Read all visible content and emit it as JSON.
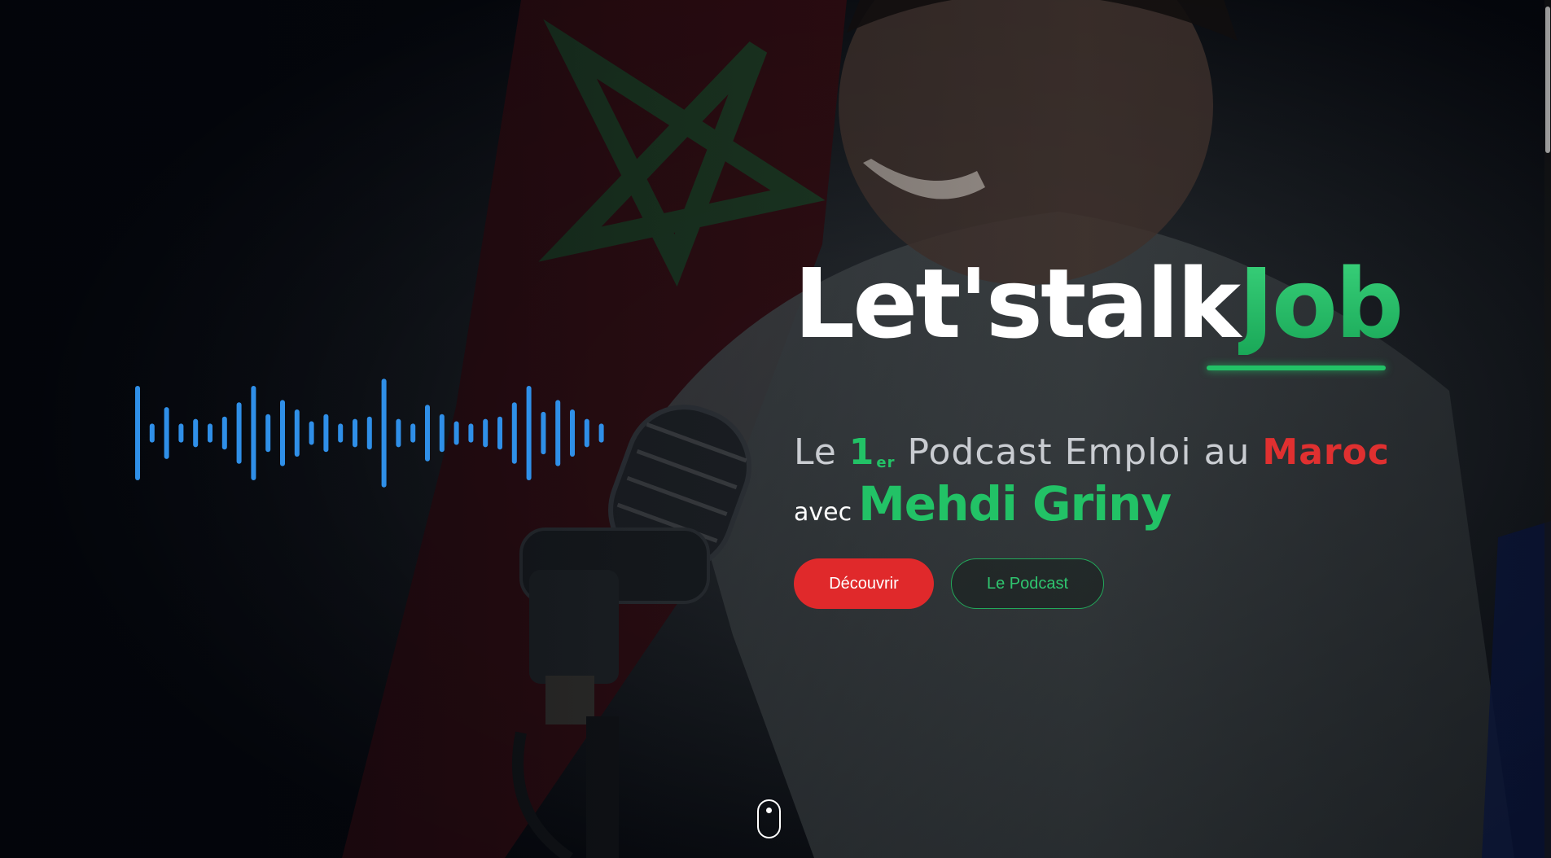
{
  "hero": {
    "title_part1": "Let'stalk",
    "title_part2": "Job",
    "tagline_prefix": "Le ",
    "tagline_rank": "1",
    "tagline_rank_suffix": "er",
    "tagline_middle": " Podcast Emploi au ",
    "tagline_country": "Maroc",
    "host_prefix": "avec",
    "host_name": "Mehdi Griny"
  },
  "buttons": {
    "discover_label": "Découvrir",
    "podcast_label": "Le Podcast"
  },
  "waveform": {
    "color": "#2f8fe8",
    "bar_levels": [
      1.0,
      0.2,
      0.55,
      0.2,
      0.3,
      0.2,
      0.35,
      0.65,
      1.0,
      0.4,
      0.7,
      0.5,
      0.25,
      0.4,
      0.2,
      0.3,
      0.35,
      1.15,
      0.3,
      0.2,
      0.6,
      0.4,
      0.25,
      0.2,
      0.3,
      0.35,
      0.65,
      1.0,
      0.45,
      0.7,
      0.5,
      0.3,
      0.2
    ]
  },
  "colors": {
    "accent_green": "#22c266",
    "accent_red": "#e0292b",
    "waveform_blue": "#2f8fe8"
  },
  "icons": {
    "scroll": "mouse-scroll-icon"
  }
}
